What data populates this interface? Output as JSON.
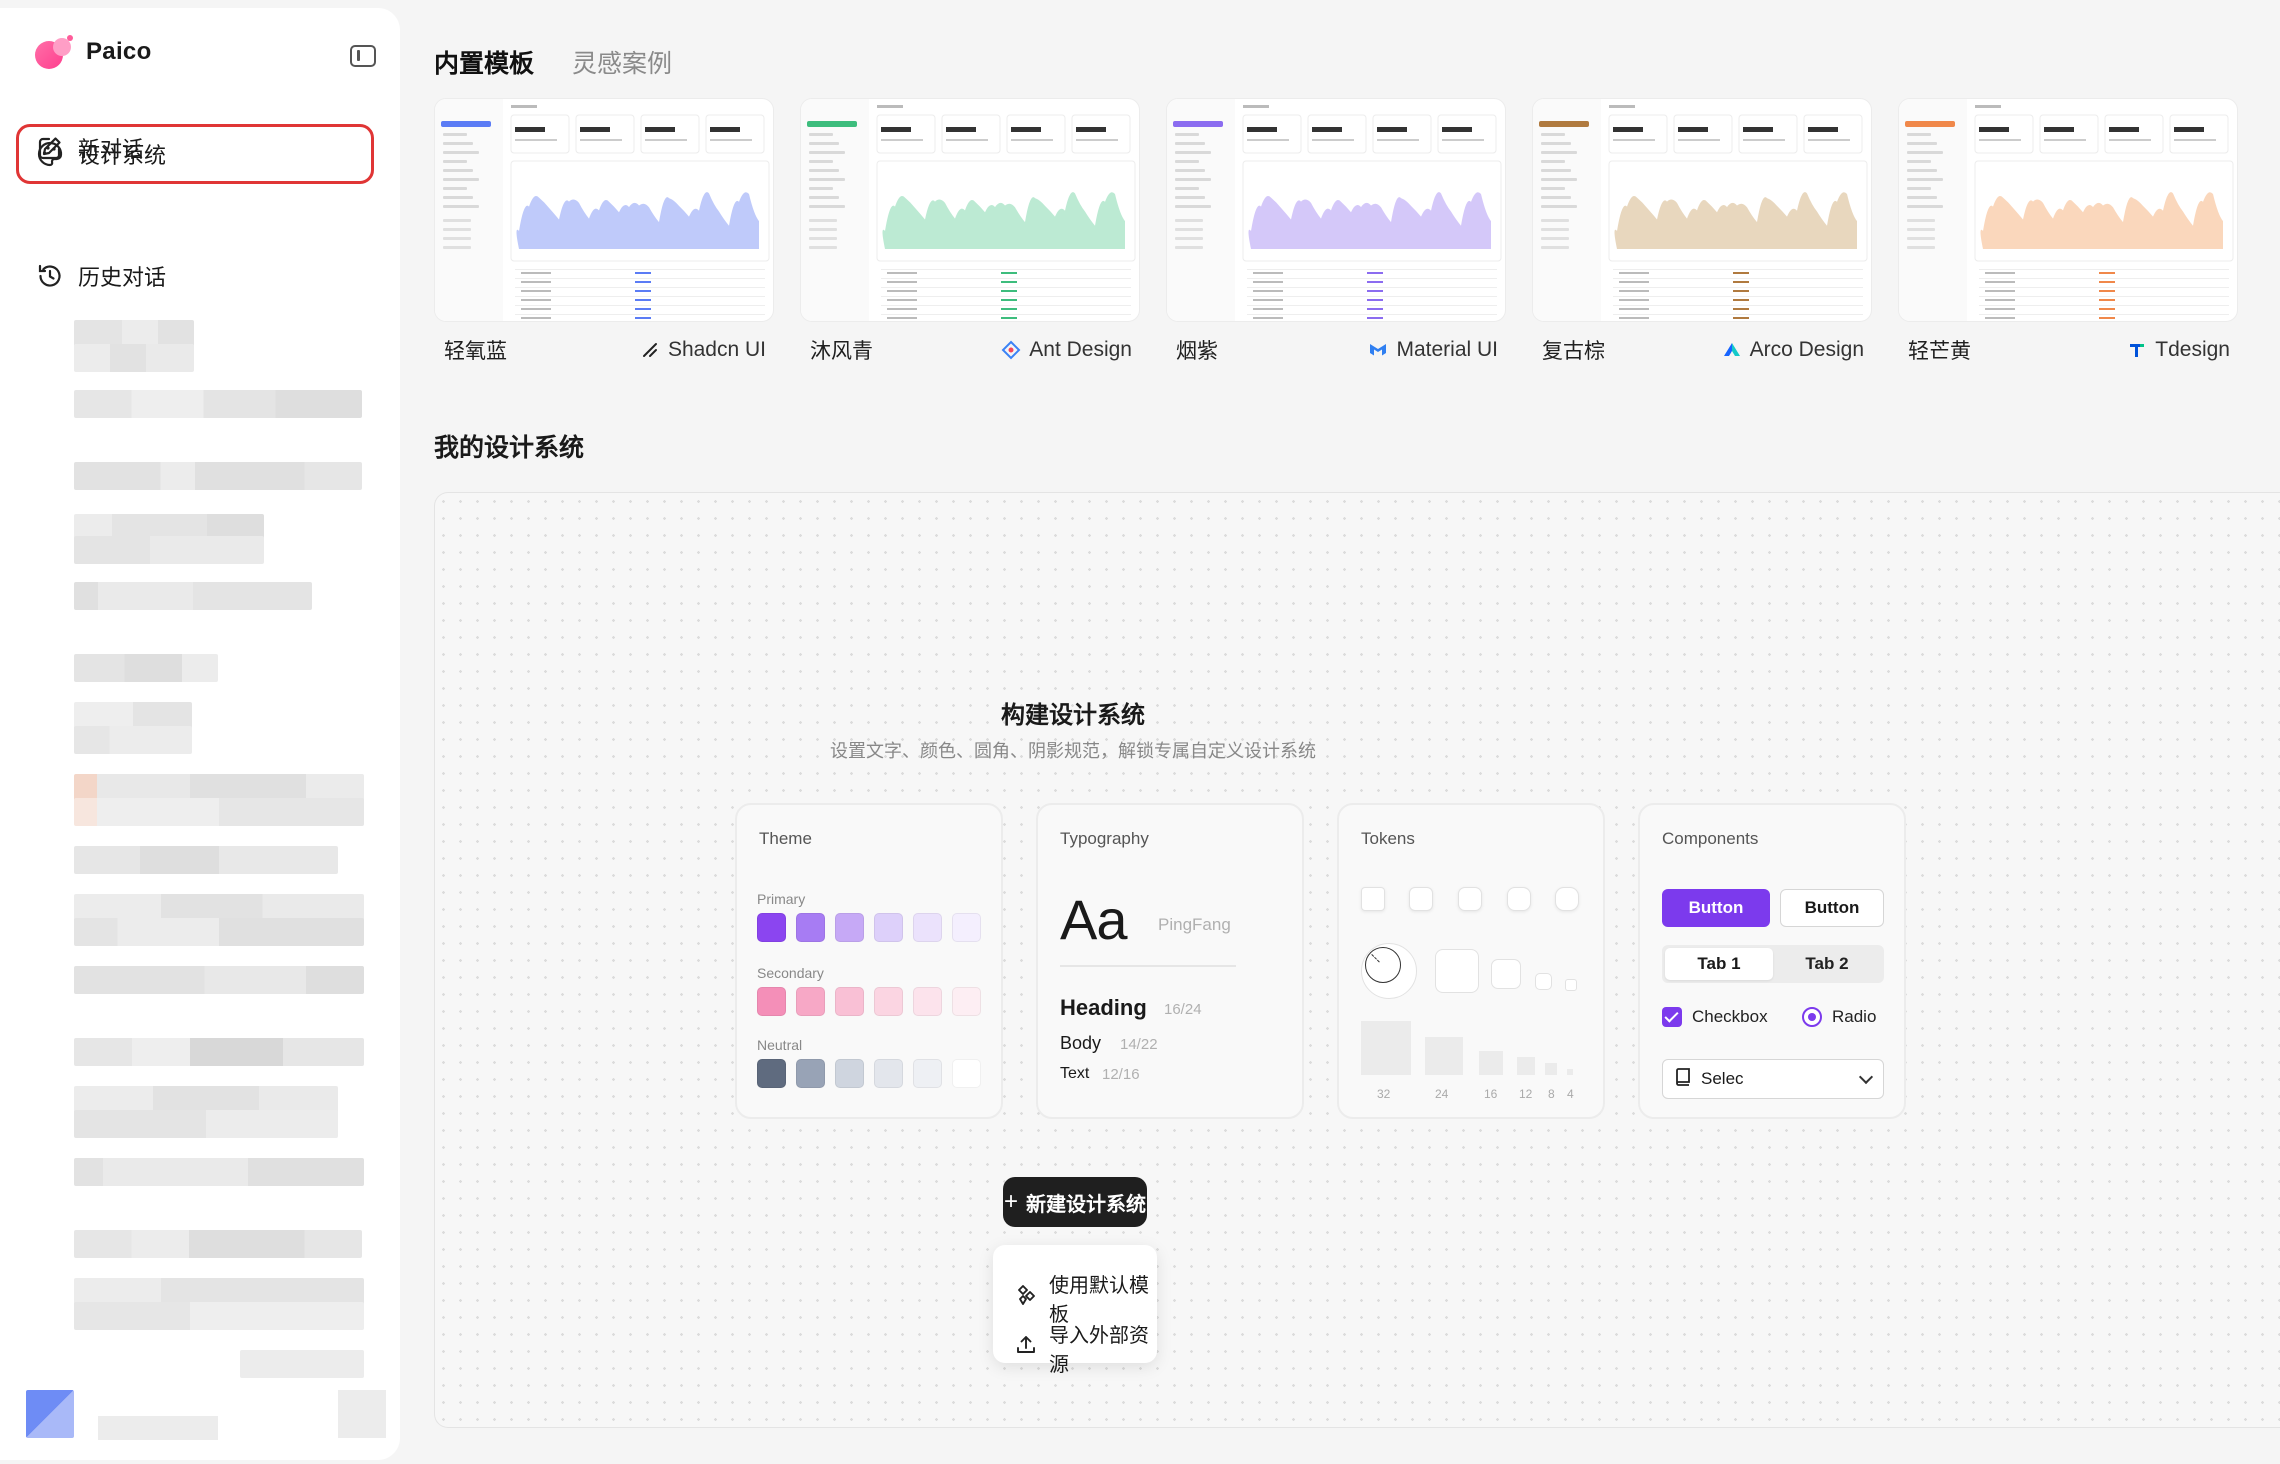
{
  "app": {
    "name": "Paico"
  },
  "nav": {
    "items": [
      {
        "label": "新对话",
        "icon": "new-chat-icon"
      },
      {
        "label": "设计系统",
        "icon": "palette-icon"
      },
      {
        "label": "历史对话",
        "icon": "history-icon"
      }
    ]
  },
  "tabs": [
    {
      "label": "内置模板",
      "active": true
    },
    {
      "label": "灵感案例",
      "active": false
    }
  ],
  "templates": [
    {
      "name": "轻氧蓝",
      "library": "Shadcn UI",
      "icon": "shadcn-icon",
      "accent": "#5b7cf5",
      "chart": "#a9b8f8"
    },
    {
      "name": "沐风青",
      "library": "Ant Design",
      "icon": "antdesign-icon",
      "accent": "#3dbd7d",
      "chart": "#a6e3c4"
    },
    {
      "name": "烟紫",
      "library": "Material UI",
      "icon": "materialui-icon",
      "accent": "#8b6cf0",
      "chart": "#c6b6f7"
    },
    {
      "name": "复古棕",
      "library": "Arco Design",
      "icon": "arcodesign-icon",
      "accent": "#b07a3f",
      "chart": "#e0c9a8"
    },
    {
      "name": "轻芒黄",
      "library": "Tdesign",
      "icon": "tdesign-icon",
      "accent": "#f0884a",
      "chart": "#f8c9a6"
    }
  ],
  "section": {
    "title": "我的设计系统"
  },
  "build": {
    "title": "构建设计系统",
    "subtitle": "设置文字、颜色、圆角、阴影规范，解锁专属自定义设计系统"
  },
  "theme_card": {
    "title": "Theme",
    "primary_label": "Primary",
    "secondary_label": "Secondary",
    "neutral_label": "Neutral",
    "primary": [
      "#8b45f0",
      "#a77cf3",
      "#c6a9f6",
      "#ddd0fa",
      "#ebe2fc",
      "#f4effe"
    ],
    "secondary": [
      "#f48fb8",
      "#f7a8c6",
      "#f9c0d5",
      "#fbd5e2",
      "#fce3ec",
      "#fdeef3"
    ],
    "neutral": [
      "#5f6b7f",
      "#98a3b6",
      "#cfd5df",
      "#e3e6ec",
      "#eef0f4",
      "#ffffff"
    ]
  },
  "typography_card": {
    "title": "Typography",
    "sample": "Aa",
    "font": "PingFang",
    "heading": "Heading",
    "heading_size": "16/24",
    "body": "Body",
    "body_size": "14/22",
    "text": "Text",
    "text_size": "12/16"
  },
  "tokens_card": {
    "title": "Tokens",
    "spacing": [
      "32",
      "24",
      "16",
      "12",
      "8",
      "4"
    ]
  },
  "components_card": {
    "title": "Components",
    "primary_button": "Button",
    "outline_button": "Button",
    "tab1": "Tab 1",
    "tab2": "Tab 2",
    "checkbox": "Checkbox",
    "radio": "Radio",
    "select": "Selec"
  },
  "actions": {
    "new_button": "新建设计系统",
    "menu": [
      {
        "label": "使用默认模板",
        "icon": "template-icon"
      },
      {
        "label": "导入外部资源",
        "icon": "upload-icon"
      }
    ]
  }
}
